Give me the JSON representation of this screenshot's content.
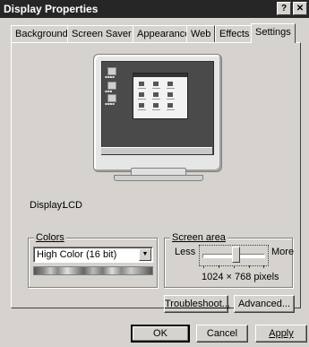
{
  "window": {
    "title": "Display Properties",
    "help_glyph": "?",
    "close_glyph": "✕"
  },
  "tabs": [
    {
      "label": "Background"
    },
    {
      "label": "Screen Saver"
    },
    {
      "label": "Appearance"
    },
    {
      "label": "Web"
    },
    {
      "label": "Effects"
    },
    {
      "label": "Settings",
      "active": true
    }
  ],
  "display": {
    "label": "Display:",
    "value": "LCD"
  },
  "colors": {
    "group_label": "Colors",
    "selected": "High Color (16 bit)"
  },
  "screen_area": {
    "group_label": "Screen area",
    "less": "Less",
    "more": "More",
    "resolution": "1024 × 768 pixels",
    "slider_level": 0.55
  },
  "buttons": {
    "troubleshoot": "Troubleshoot...",
    "advanced": "Advanced...",
    "ok": "OK",
    "cancel": "Cancel",
    "apply": "Apply"
  }
}
